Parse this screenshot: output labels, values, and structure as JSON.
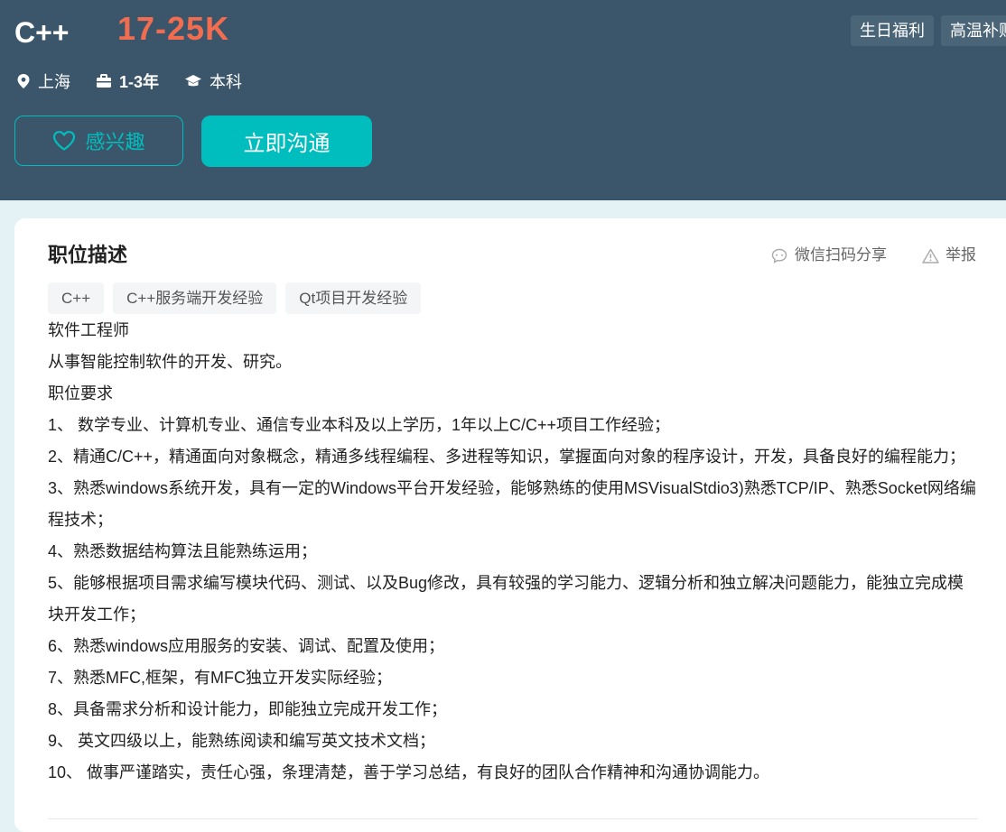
{
  "job": {
    "title": "C++",
    "salary": "17-25K",
    "benefits": [
      "生日福利",
      "高温补贴"
    ],
    "meta": {
      "location": "上海",
      "experience": "1-3年",
      "degree": "本科"
    },
    "actions": {
      "interest_label": "感兴趣",
      "chat_label": "立即沟通"
    }
  },
  "description": {
    "section_title": "职位描述",
    "share_label": "微信扫码分享",
    "report_label": "举报",
    "skill_tags": [
      "C++",
      "C++服务端开发经验",
      "Qt项目开发经验"
    ],
    "lines": [
      "软件工程师",
      "从事智能控制软件的开发、研究。",
      "职位要求",
      "1、 数学专业、计算机专业、通信专业本科及以上学历，1年以上C/C++项目工作经验；",
      "2、精通C/C++，精通面向对象概念，精通多线程编程、多进程等知识，掌握面向对象的程序设计，开发，具备良好的编程能力；",
      "3、熟悉windows系统开发，具有一定的Windows平台开发经验，能够熟练的使用MSVisualStdio3)熟悉TCP/IP、熟悉Socket网络编程技术；",
      "4、熟悉数据结构算法且能熟练运用；",
      "5、能够根据项目需求编写模块代码、测试、以及Bug修改，具有较强的学习能力、逻辑分析和独立解决问题能力，能独立完成模块开发工作；",
      "6、熟悉windows应用服务的安装、调试、配置及使用；",
      "7、熟悉MFC,框架，有MFC独立开发实际经验；",
      "8、具备需求分析和设计能力，即能独立完成开发工作；",
      "9、 英文四级以上，能熟练阅读和编写英文技术文档；",
      "10、 做事严谨踏实，责任心强，条理清楚，善于学习总结，有良好的团队合作精神和沟通协调能力。"
    ]
  },
  "colors": {
    "header_bg": "#3b566b",
    "salary": "#f26d4f",
    "accent": "#00bebd"
  },
  "icons": [
    "location-icon",
    "briefcase-icon",
    "graduation-cap-icon",
    "heart-icon",
    "chat-bubble-icon",
    "warning-icon"
  ]
}
